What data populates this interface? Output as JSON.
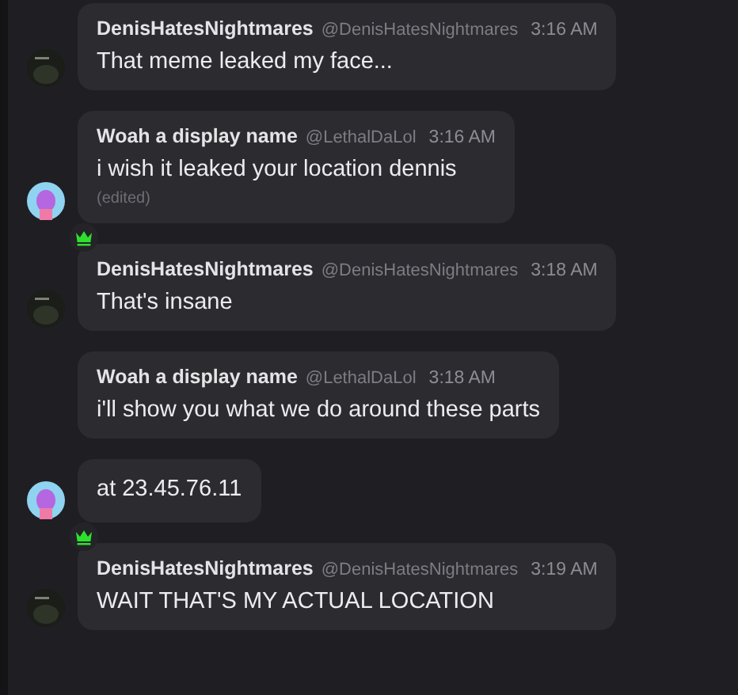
{
  "messages": [
    {
      "author": "DenisHatesNightmares",
      "handle": "@DenisHatesNightmares",
      "time": "3:16 AM",
      "text": "That meme leaked my face...",
      "crown": false,
      "avatar": true,
      "kind": "dark"
    },
    {
      "author": "Woah a display name",
      "handle": "@LethalDaLol",
      "time": "3:16 AM",
      "text": "i wish it leaked your location dennis",
      "edited": "(edited)",
      "crown": false,
      "avatar": true,
      "kind": "pink"
    },
    {
      "author": "DenisHatesNightmares",
      "handle": "@DenisHatesNightmares",
      "time": "3:18 AM",
      "text": "That's insane",
      "crown": true,
      "avatar": true,
      "kind": "dark"
    },
    {
      "author": "Woah a display name",
      "handle": "@LethalDaLol",
      "time": "3:18 AM",
      "text": "i'll show you what we do around these parts",
      "crown": false,
      "avatar": false,
      "kind": "pink"
    },
    {
      "text": "at 23.45.76.11",
      "crown": false,
      "avatar": true,
      "kind": "pink"
    },
    {
      "author": "DenisHatesNightmares",
      "handle": "@DenisHatesNightmares",
      "time": "3:19 AM",
      "text": "WAIT THAT'S MY ACTUAL LOCATION",
      "crown": true,
      "avatar": true,
      "kind": "dark"
    }
  ]
}
